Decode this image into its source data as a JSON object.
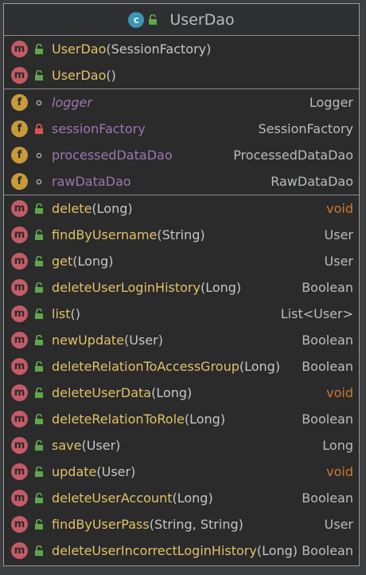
{
  "header": {
    "class_icon_letter": "c",
    "title": "UserDao"
  },
  "constructors": [
    {
      "name": "UserDao",
      "params": "(SessionFactory)"
    },
    {
      "name": "UserDao",
      "params": "()"
    }
  ],
  "fields": [
    {
      "kind": "f",
      "name": "logger",
      "type": "Logger",
      "visibility": "package-private",
      "italic": true
    },
    {
      "kind": "f",
      "name": "sessionFactory",
      "type": "SessionFactory",
      "visibility": "private",
      "italic": false
    },
    {
      "kind": "f",
      "name": "processedDataDao",
      "type": "ProcessedDataDao",
      "visibility": "package-private",
      "italic": false
    },
    {
      "kind": "f",
      "name": "rawDataDao",
      "type": "RawDataDao",
      "visibility": "package-private",
      "italic": false
    }
  ],
  "methods": [
    {
      "name": "delete",
      "params": "(Long)",
      "type": "void"
    },
    {
      "name": "findByUsername",
      "params": "(String)",
      "type": "User"
    },
    {
      "name": "get",
      "params": "(Long)",
      "type": "User"
    },
    {
      "name": "deleteUserLoginHistory",
      "params": "(Long)",
      "type": "Boolean"
    },
    {
      "name": "list",
      "params": "()",
      "type": "List<User>"
    },
    {
      "name": "newUpdate",
      "params": "(User)",
      "type": "Boolean"
    },
    {
      "name": "deleteRelationToAccessGroup",
      "params": "(Long)",
      "type": "Boolean"
    },
    {
      "name": "deleteUserData",
      "params": "(Long)",
      "type": "void"
    },
    {
      "name": "deleteRelationToRole",
      "params": "(Long)",
      "type": "Boolean"
    },
    {
      "name": "save",
      "params": "(User)",
      "type": "Long"
    },
    {
      "name": "update",
      "params": "(User)",
      "type": "void"
    },
    {
      "name": "deleteUserAccount",
      "params": "(Long)",
      "type": "Boolean"
    },
    {
      "name": "findByUserPass",
      "params": "(String, String)",
      "type": "User"
    },
    {
      "name": "deleteUserIncorrectLoginHistory",
      "params": "(Long)",
      "type": "Boolean"
    }
  ],
  "icons": {
    "method_badge": "m",
    "field_badge": "f",
    "public_icon": "unlocked-padlock-icon",
    "private_icon": "locked-padlock-icon",
    "package_icon": "dot-icon"
  },
  "colors": {
    "background": "#2b2b2b",
    "method_name": "#e1c268",
    "field_name": "#9b77b0",
    "void_type": "#cc7832",
    "type": "#b9bcbf",
    "method_badge": "#c45b67",
    "field_badge": "#c99a3a",
    "public_lock": "#5ea64c",
    "private_lock": "#d9534f"
  }
}
